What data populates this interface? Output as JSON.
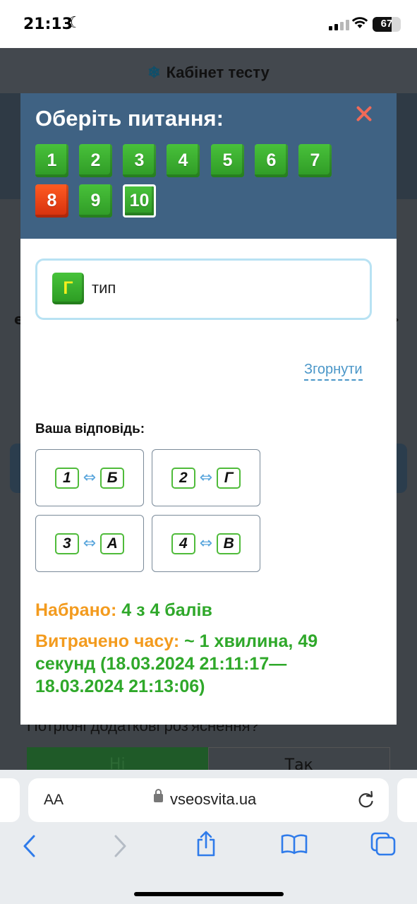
{
  "status_bar": {
    "time": "21:13",
    "battery": "67"
  },
  "background_page": {
    "header_title": "Кабінет тесту",
    "question_text": "Потрібні додаткові роз'яснення?",
    "button_no": "Ні",
    "button_yes": "Так"
  },
  "modal": {
    "title": "Оберіть питання:",
    "questions": [
      {
        "label": "1",
        "state": "correct"
      },
      {
        "label": "2",
        "state": "correct"
      },
      {
        "label": "3",
        "state": "correct"
      },
      {
        "label": "4",
        "state": "correct"
      },
      {
        "label": "5",
        "state": "correct"
      },
      {
        "label": "6",
        "state": "correct"
      },
      {
        "label": "7",
        "state": "correct"
      },
      {
        "label": "8",
        "state": "wrong"
      },
      {
        "label": "9",
        "state": "correct"
      },
      {
        "label": "10",
        "state": "current"
      }
    ],
    "answer_option": {
      "letter": "Г",
      "text": "тип"
    },
    "collapse_link": "Згорнути",
    "your_answer_label": "Ваша відповідь:",
    "pairs": [
      {
        "left": "1",
        "right": "Б"
      },
      {
        "left": "2",
        "right": "Г"
      },
      {
        "left": "3",
        "right": "А"
      },
      {
        "left": "4",
        "right": "В"
      }
    ],
    "score_label": "Набрано:",
    "score_value": "4 з 4 балів",
    "time_label": "Витрачено часу:",
    "time_value": "~ 1 хвилина, 49 секунд (18.03.2024 21:11:17—18.03.2024 21:13:06)"
  },
  "browser": {
    "text_size_label": "AA",
    "url": "vseosvita.ua"
  },
  "colors": {
    "modal_header": "#3f6283",
    "correct": "#2fa82a",
    "wrong": "#e23b14",
    "accent_orange": "#f39b1e",
    "link": "#4a96c8"
  }
}
